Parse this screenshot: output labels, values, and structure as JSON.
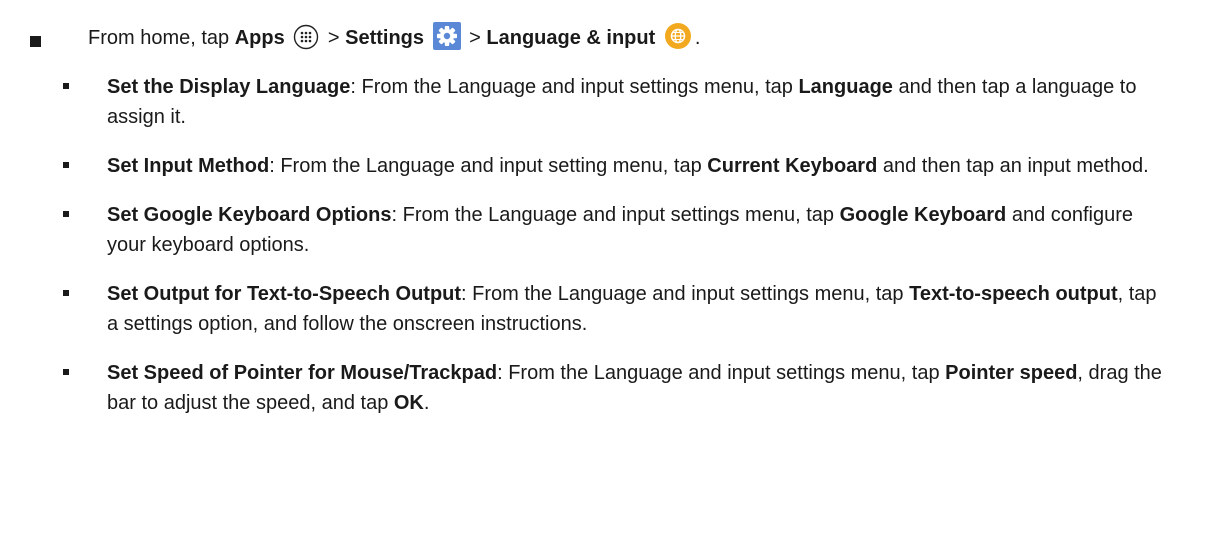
{
  "intro": {
    "prefix": "From home, tap",
    "apps_label": "Apps",
    "sep1": ">",
    "settings_label": "Settings",
    "sep2": ">",
    "language_label": "Language & input",
    "end": "."
  },
  "items": [
    {
      "title": "Set the Display Language",
      "text1": ": From the Language and input settings menu, tap ",
      "bold1": "Language",
      "text2": " and then tap a language to assign it."
    },
    {
      "title": "Set Input Method",
      "text1": ": From the Language and input setting menu, tap ",
      "bold1": "Current Keyboard",
      "text2": " and then tap an input method."
    },
    {
      "title": "Set Google Keyboard Options",
      "text1": ": From the Language and input settings menu, tap ",
      "bold1": "Google Keyboard",
      "text2": " and configure your keyboard options."
    },
    {
      "title": "Set Output for Text-to-Speech Output",
      "text1": ": From the Language and input settings menu, tap ",
      "bold1": "Text-to-speech output",
      "text2": ", tap a settings option, and follow the onscreen instructions."
    },
    {
      "title": "Set Speed of Pointer for Mouse/Trackpad",
      "text1": ": From the Language and input settings menu, tap ",
      "bold1": "Pointer speed",
      "text2": ", drag the bar to adjust the speed, and tap ",
      "bold2": "OK",
      "text3": "."
    }
  ],
  "icons": {
    "apps": "apps-grid-icon",
    "settings": "settings-gear-icon",
    "language": "globe-icon"
  },
  "colors": {
    "settings_icon_bg": "#5a88d6",
    "language_icon_bg": "#f2a91f"
  }
}
